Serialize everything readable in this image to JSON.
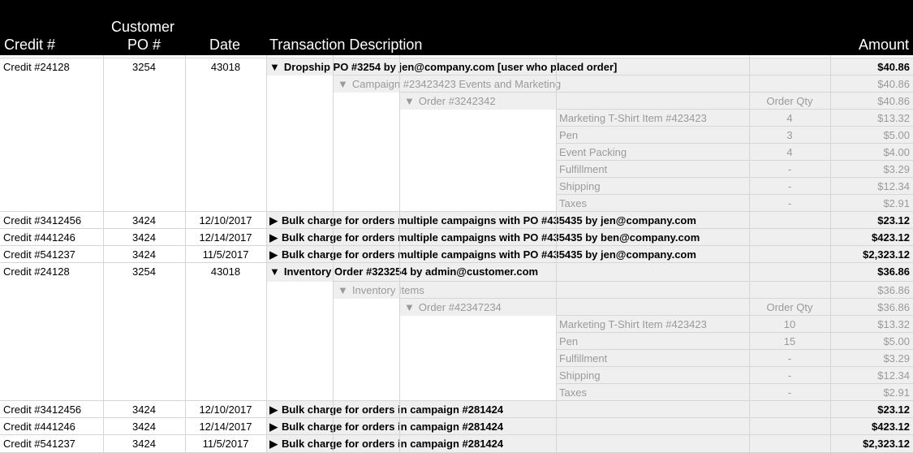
{
  "headers": {
    "credit": "Credit #",
    "customer_po": "Customer\nPO #",
    "customer_po_line1": "Customer",
    "customer_po_line2": "PO #",
    "date": "Date",
    "description": "Transaction Description",
    "amount": "Amount"
  },
  "expanded_glyph": "▼",
  "collapsed_glyph": "▶",
  "rows": [
    {
      "kind": "main",
      "credit": "Credit #24128",
      "po": "3254",
      "date": "43018",
      "desc": "Dropship PO #3254 by jen@company.com [user who placed order]",
      "amount": "$40.86",
      "expanded": true
    },
    {
      "kind": "level1",
      "desc": "Campaign #23423423  Events and Marketing",
      "amount": "$40.86"
    },
    {
      "kind": "level2",
      "desc": "Order #3242342",
      "qty": "Order Qty",
      "amount": "$40.86"
    },
    {
      "kind": "item",
      "desc": "Marketing T-Shirt Item #423423",
      "qty": "4",
      "amount": "$13.32"
    },
    {
      "kind": "item",
      "desc": "Pen",
      "qty": "3",
      "amount": "$5.00"
    },
    {
      "kind": "item",
      "desc": "Event Packing",
      "qty": "4",
      "amount": "$4.00"
    },
    {
      "kind": "item",
      "desc": "Fulfillment",
      "qty": "-",
      "amount": "$3.29"
    },
    {
      "kind": "item",
      "desc": "Shipping",
      "qty": "-",
      "amount": "$12.34"
    },
    {
      "kind": "item",
      "desc": "Taxes",
      "qty": "-",
      "amount": "$2.91"
    },
    {
      "kind": "main",
      "credit": "Credit #3412456",
      "po": "3424",
      "date": "12/10/2017",
      "desc": "Bulk charge for orders multiple campaigns with PO #435435 by jen@company.com",
      "amount": "$23.12",
      "expanded": false
    },
    {
      "kind": "main",
      "credit": "Credit #441246",
      "po": "3424",
      "date": "12/14/2017",
      "desc": "Bulk charge for orders multiple campaigns with PO #435435 by ben@company.com",
      "amount": "$423.12",
      "expanded": false
    },
    {
      "kind": "main",
      "credit": "Credit #541237",
      "po": "3424",
      "date": "11/5/2017",
      "desc": "Bulk charge for orders multiple campaigns with PO #435435 by jen@company.com",
      "amount": "$2,323.12",
      "expanded": false
    },
    {
      "kind": "main",
      "credit": "Credit #24128",
      "po": "3254",
      "date": "43018",
      "desc": "Inventory Order #323254 by admin@customer.com",
      "amount": "$36.86",
      "expanded": true
    },
    {
      "kind": "level1",
      "desc": "Inventory Items",
      "amount": "$36.86"
    },
    {
      "kind": "level2",
      "desc": "Order #42347234",
      "qty": "Order Qty",
      "amount": "$36.86"
    },
    {
      "kind": "item",
      "desc": "Marketing T-Shirt Item #423423",
      "qty": "10",
      "amount": "$13.32"
    },
    {
      "kind": "item",
      "desc": "Pen",
      "qty": "15",
      "amount": "$5.00"
    },
    {
      "kind": "item",
      "desc": "Fulfillment",
      "qty": "-",
      "amount": "$3.29"
    },
    {
      "kind": "item",
      "desc": "Shipping",
      "qty": "-",
      "amount": "$12.34"
    },
    {
      "kind": "item",
      "desc": "Taxes",
      "qty": "-",
      "amount": "$2.91"
    },
    {
      "kind": "main",
      "credit": "Credit #3412456",
      "po": "3424",
      "date": "12/10/2017",
      "desc": "Bulk charge for orders in campaign #281424",
      "amount": "$23.12",
      "expanded": false
    },
    {
      "kind": "main",
      "credit": "Credit #441246",
      "po": "3424",
      "date": "12/14/2017",
      "desc": "Bulk charge for orders in campaign #281424",
      "amount": "$423.12",
      "expanded": false
    },
    {
      "kind": "main",
      "credit": "Credit #541237",
      "po": "3424",
      "date": "11/5/2017",
      "desc": "Bulk charge for orders in campaign #281424",
      "amount": "$2,323.12",
      "expanded": false
    }
  ]
}
